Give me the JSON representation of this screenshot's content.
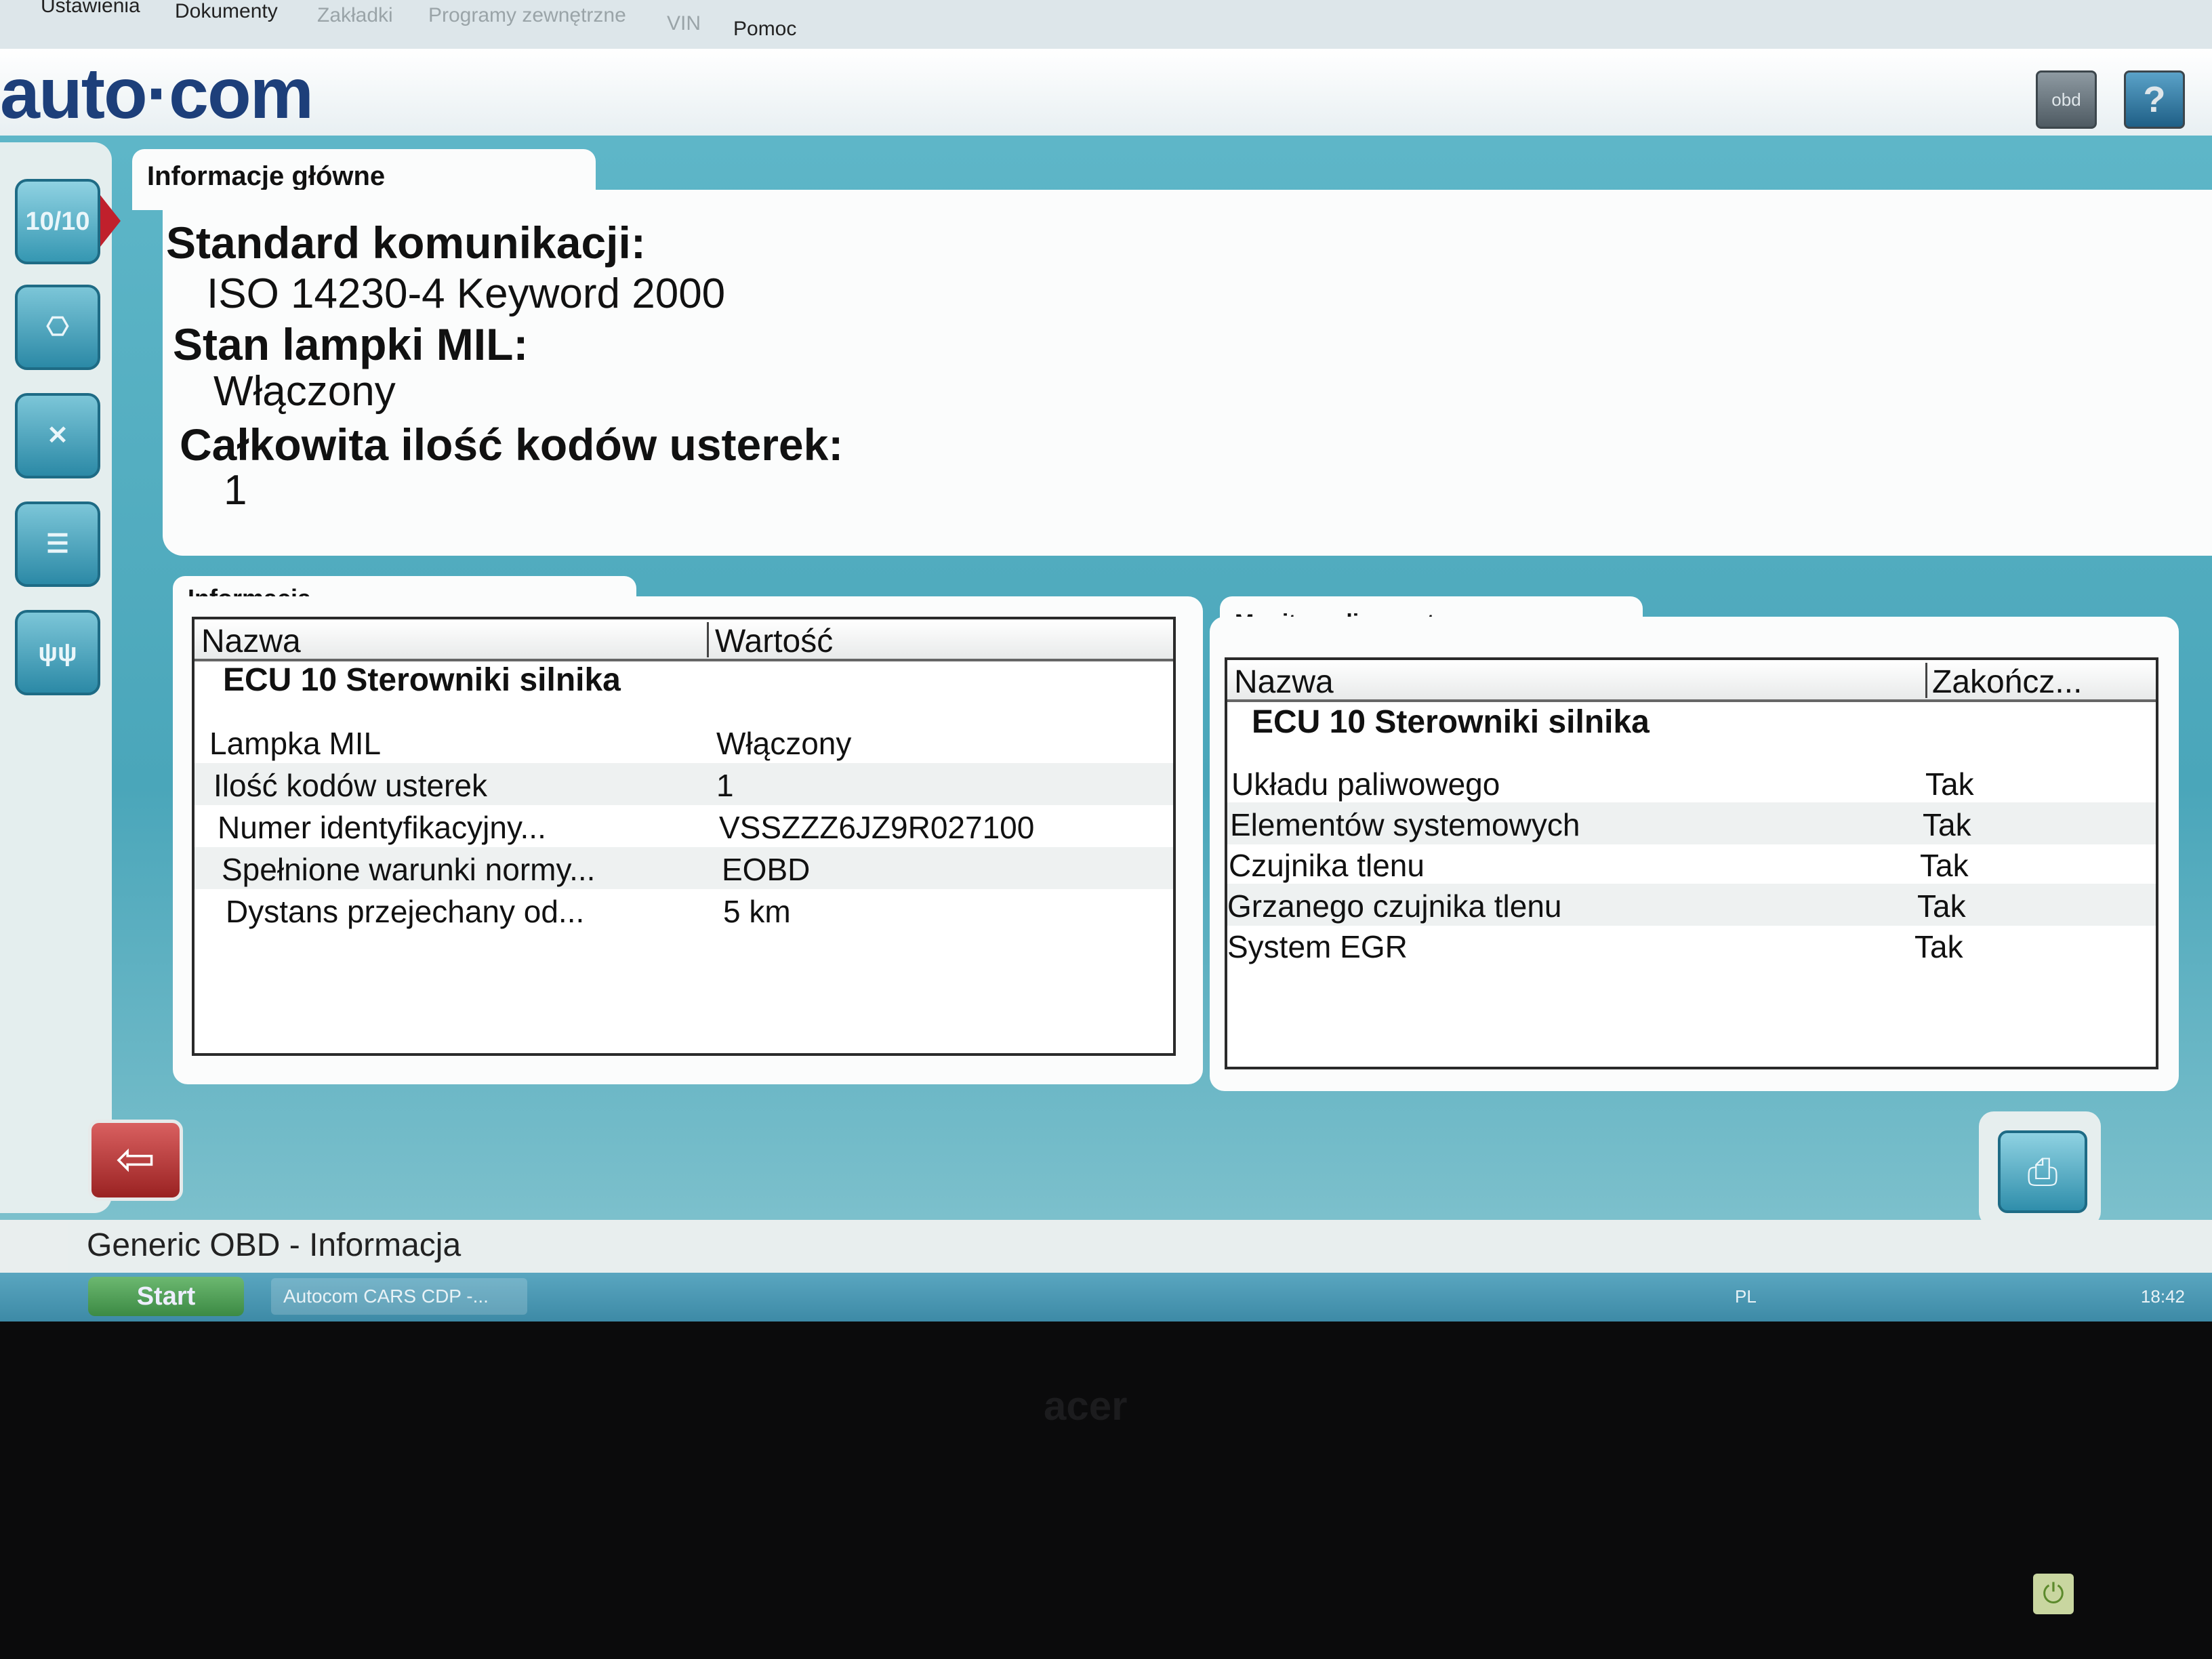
{
  "menu": {
    "items": [
      {
        "label": "Ustawienia",
        "dim": false
      },
      {
        "label": "Dokumenty",
        "dim": false
      },
      {
        "label": "Zakładki",
        "dim": true
      },
      {
        "label": "Programy zewnętrzne",
        "dim": true
      },
      {
        "label": "VIN",
        "dim": true
      },
      {
        "label": "Pomoc",
        "dim": false
      }
    ]
  },
  "header": {
    "logo": "auto·com",
    "obd_button": "obd",
    "help_button": "?"
  },
  "sidebar": {
    "buttons": [
      {
        "label": "10/10",
        "icon": "info-person-icon"
      },
      {
        "label": "",
        "icon": "engine-icon"
      },
      {
        "label": "",
        "icon": "engine-clear-icon"
      },
      {
        "label": "",
        "icon": "live-data-icon"
      },
      {
        "label": "",
        "icon": "oxygen-sensor-icon"
      }
    ]
  },
  "main_info": {
    "tab_title": "Informacje główne",
    "communication_label": "Standard komunikacji:",
    "communication_value": "ISO 14230-4 Keyword 2000",
    "mil_label": "Stan lampki MIL:",
    "mil_value": "Włączony",
    "codes_label": "Całkowita ilość kodów usterek:",
    "codes_value": "1"
  },
  "info_panel": {
    "tab_title": "Informacja",
    "col_name": "Nazwa",
    "col_value": "Wartość",
    "group": "ECU 10 Sterowniki silnika",
    "rows": [
      {
        "name": "Lampka MIL",
        "value": "Włączony"
      },
      {
        "name": "Ilość kodów usterek",
        "value": "1"
      },
      {
        "name": "Numer identyfikacyjny...",
        "value": "VSSZZZ6JZ9R027100"
      },
      {
        "name": "Spełnione warunki normy...",
        "value": "EOBD"
      },
      {
        "name": "Dystans przejechany od...",
        "value": "5 km"
      }
    ]
  },
  "monitors_panel": {
    "tab_title": "Monitory diagnostyczne",
    "col_name": "Nazwa",
    "col_done": "Zakończ...",
    "group": "ECU 10 Sterowniki silnika",
    "rows": [
      {
        "name": "Układu paliwowego",
        "value": "Tak"
      },
      {
        "name": "Elementów systemowych",
        "value": "Tak"
      },
      {
        "name": "Czujnika tlenu",
        "value": "Tak"
      },
      {
        "name": "Grzanego czujnika tlenu",
        "value": "Tak"
      },
      {
        "name": "System EGR",
        "value": "Tak"
      }
    ]
  },
  "status": {
    "text": "Generic OBD - Informacja"
  },
  "taskbar": {
    "start": "Start",
    "task": "Autocom CARS CDP -...",
    "lang": "PL",
    "clock": "18:42"
  }
}
